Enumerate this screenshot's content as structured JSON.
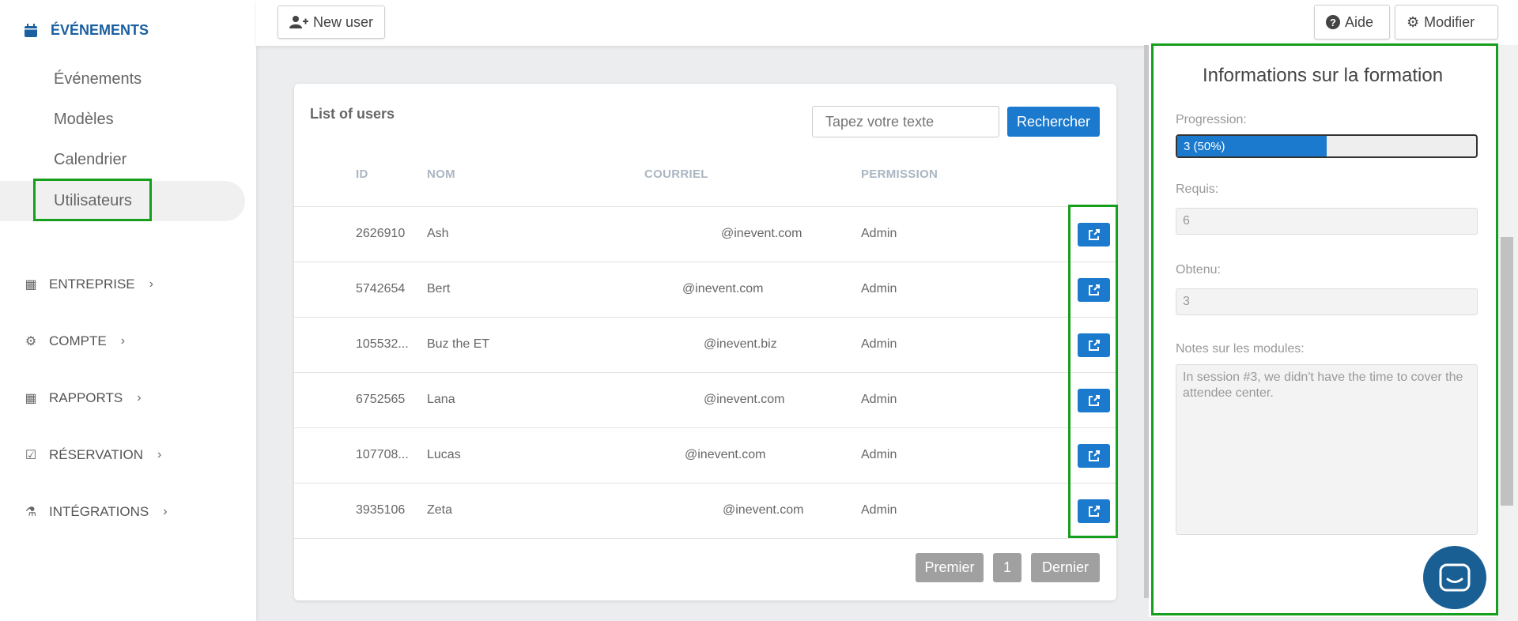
{
  "sidebar": {
    "section_title": "ÉVÉNEMENTS",
    "sub_items": [
      "Événements",
      "Modèles",
      "Calendrier",
      "Utilisateurs"
    ],
    "groups": [
      "ENTREPRISE",
      "COMPTE",
      "RAPPORTS",
      "RÉSERVATION",
      "INTÉGRATIONS"
    ]
  },
  "toolbar": {
    "new_user": "New user",
    "help": "Aide",
    "modify": "Modifier"
  },
  "users": {
    "title": "List of users",
    "search_placeholder": "Tapez votre texte",
    "search_button": "Rechercher",
    "columns": [
      "ID",
      "NOM",
      "COURRIEL",
      "PERMISSION"
    ],
    "rows": [
      {
        "id": "2626910",
        "name": "Ash",
        "email": "@inevent.com",
        "permission": "Admin"
      },
      {
        "id": "5742654",
        "name": "Bert",
        "email": "@inevent.com",
        "permission": "Admin"
      },
      {
        "id": "105532...",
        "name": "Buz the ET",
        "email": "@inevent.biz",
        "permission": "Admin"
      },
      {
        "id": "6752565",
        "name": "Lana",
        "email": "@inevent.com",
        "permission": "Admin"
      },
      {
        "id": "107708...",
        "name": "Lucas",
        "email": "@inevent.com",
        "permission": "Admin"
      },
      {
        "id": "3935106",
        "name": "Zeta",
        "email": "@inevent.com",
        "permission": "Admin"
      }
    ],
    "pager": {
      "first": "Premier",
      "page": "1",
      "last": "Dernier"
    }
  },
  "panel": {
    "title": "Informations sur la formation",
    "progress_label": "Progression:",
    "progress_text": "3 (50%)",
    "progress_fraction": 0.5,
    "required_label": "Requis:",
    "required_value": "6",
    "obtained_label": "Obtenu:",
    "obtained_value": "3",
    "notes_label": "Notes sur les modules:",
    "notes_value": "In session #3, we didn't have the time to cover the attendee center."
  },
  "colors": {
    "accent": "#1b7acd",
    "highlight": "#169e1d",
    "brand": "#1a5fa0"
  }
}
